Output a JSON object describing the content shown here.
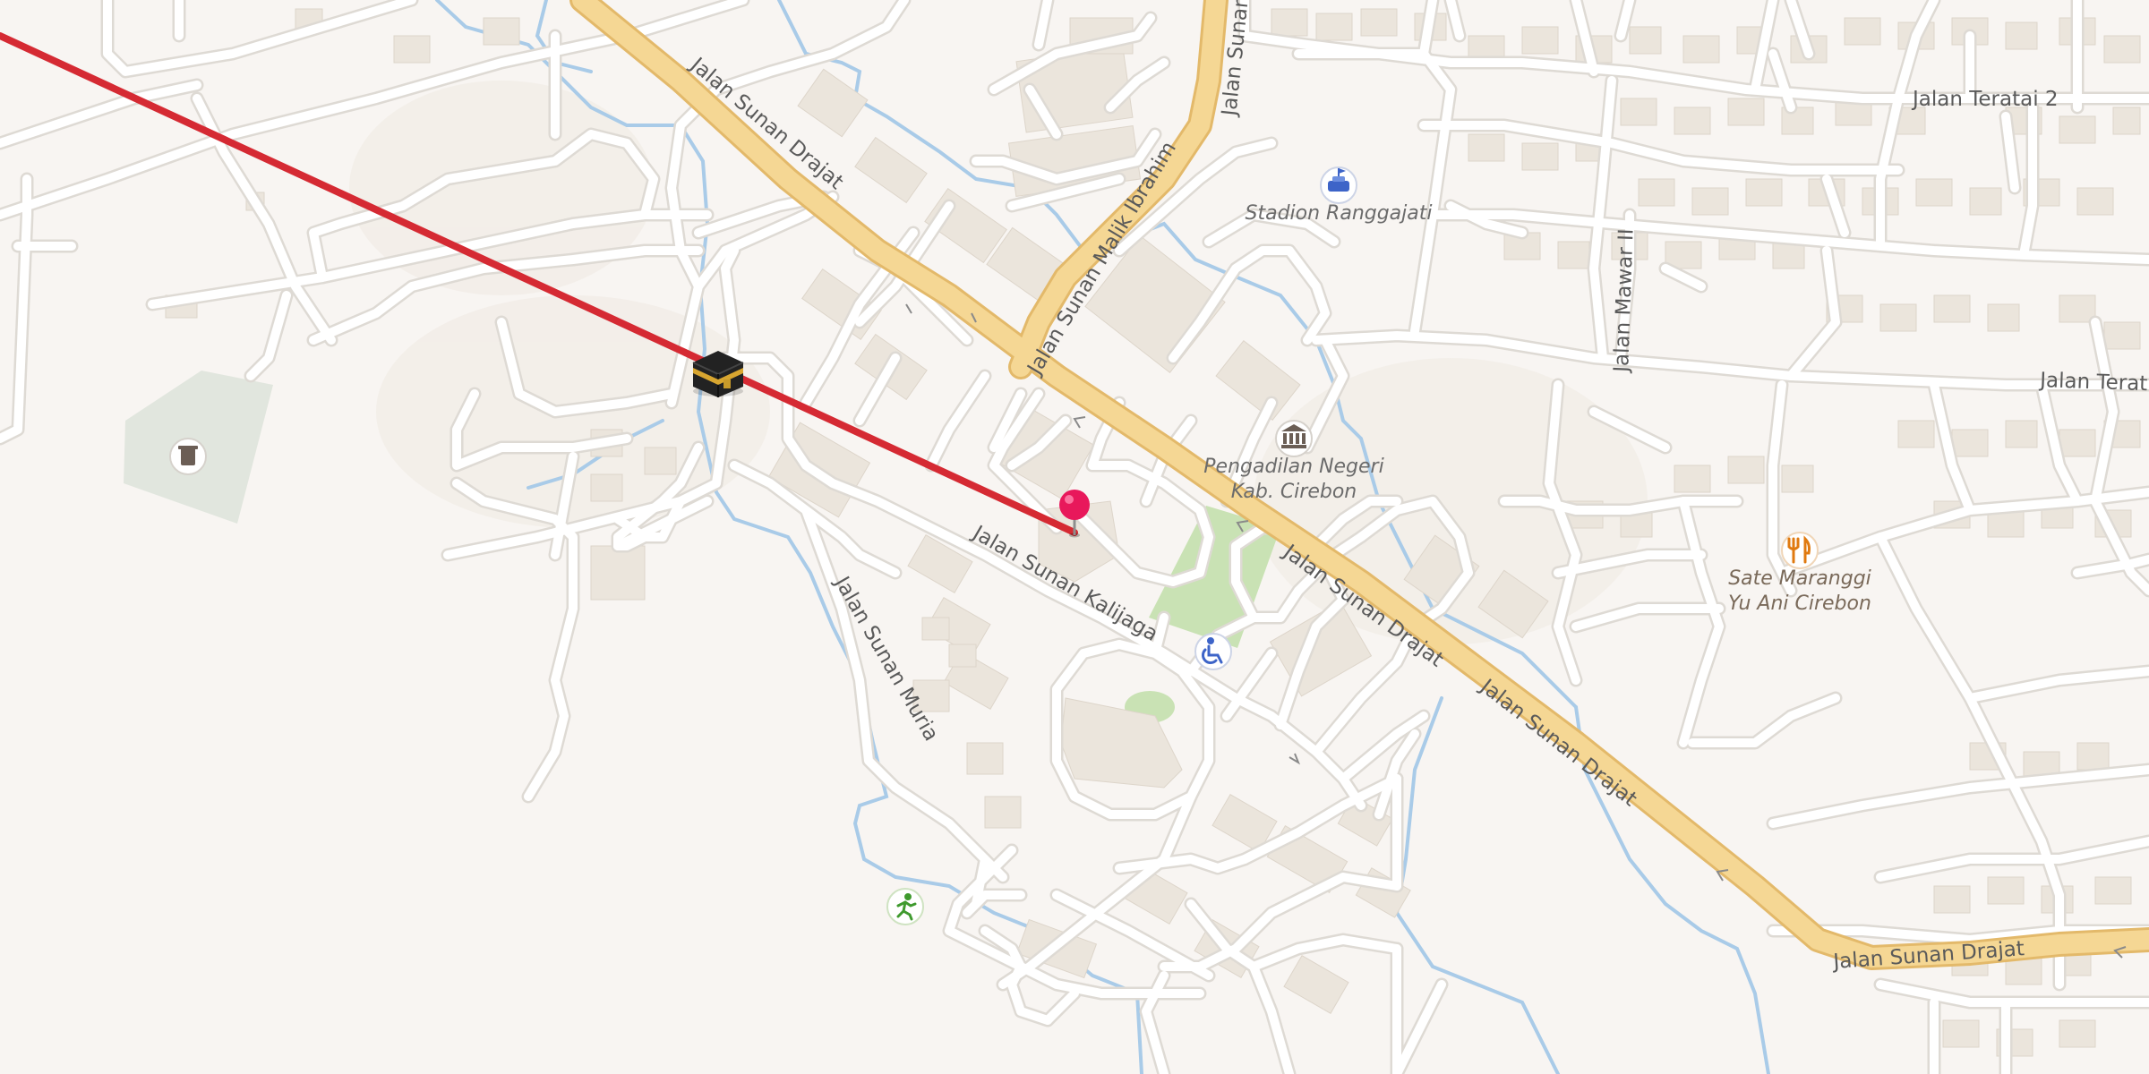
{
  "map": {
    "colors": {
      "land": "#f8f5f2",
      "building": "#ebe5dc",
      "minor_road": "#ffffff",
      "minor_road_casing": "#dedad4",
      "major_road": "#f5d794",
      "major_road_casing": "#e3b96a",
      "water": "#a9cbe8",
      "park": "#c9e2b4",
      "cemetery": "#e1e6de",
      "qibla_line": "#d52a33",
      "pin": "#e8185b"
    },
    "road_labels": [
      "Jalan Sunan Drajat",
      "Jalan Sunan",
      "Jalan Sunan Malik Ibrahim",
      "Jalan Teratai 2",
      "Jalan Mawar II",
      "Jalan Terat",
      "Jalan Sunan Drajat",
      "Jalan Sunan Drajat",
      "Jalan Sunan Kalijaga",
      "Jalan Sunan Muria",
      "Jalan Sunan Drajat"
    ],
    "pois": [
      {
        "name": "Stadion Ranggajati",
        "icon": "stadium-icon"
      },
      {
        "name": "Pengadilan Negeri Kab. Cirebon",
        "line1": "Pengadilan Negeri",
        "line2": "Kab. Cirebon",
        "icon": "courthouse-icon"
      },
      {
        "name": "Sate Maranggi Yu Ani Cirebon",
        "line1": "Sate Maranggi",
        "line2": "Yu Ani Cirebon",
        "icon": "restaurant-icon"
      }
    ],
    "unlabeled_icons": [
      "cemetery-icon",
      "accessibility-icon",
      "sports-icon"
    ],
    "overlays": {
      "qibla": {
        "icon": "kaaba-icon"
      },
      "location": {
        "icon": "map-pin-icon"
      }
    }
  }
}
